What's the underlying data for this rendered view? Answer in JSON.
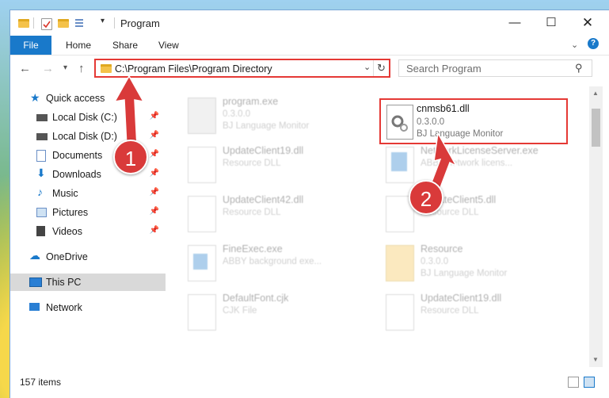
{
  "window": {
    "title": "Program"
  },
  "ribbon": {
    "file": "File",
    "tabs": [
      "Home",
      "Share",
      "View"
    ]
  },
  "address": {
    "path": "C:\\Program Files\\Program Directory"
  },
  "search": {
    "placeholder": "Search Program"
  },
  "sidebar": {
    "items": [
      {
        "label": "Quick access"
      },
      {
        "label": "Local Disk (C:)"
      },
      {
        "label": "Local Disk (D:)"
      },
      {
        "label": "Documents"
      },
      {
        "label": "Downloads"
      },
      {
        "label": "Music"
      },
      {
        "label": "Pictures"
      },
      {
        "label": "Videos"
      },
      {
        "label": "OneDrive"
      },
      {
        "label": "This PC"
      },
      {
        "label": "Network"
      }
    ]
  },
  "files": [
    {
      "name": "program.exe",
      "line1": "0.3.0.0",
      "line2": "BJ Language Monitor"
    },
    {
      "name": "cnmsb61.dll",
      "line1": "0.3.0.0",
      "line2": "BJ Language Monitor"
    },
    {
      "name": "UpdateClient19.dll",
      "line1": "Resource DLL"
    },
    {
      "name": "NetworkLicenseServer.exe",
      "line1": "ABBY network licens..."
    },
    {
      "name": "UpdateClient42.dll",
      "line1": "Resource DLL"
    },
    {
      "name": "UpdateClient5.dll",
      "line1": "Resource DLL"
    },
    {
      "name": "FineExec.exe",
      "line1": "ABBY background exe..."
    },
    {
      "name": "Resource",
      "line1": "0.3.0.0",
      "line2": "BJ Language Monitor"
    },
    {
      "name": "DefaultFont.cjk",
      "line1": "CJK File"
    },
    {
      "name": "UpdateClient19.dll",
      "line1": "Resource DLL"
    }
  ],
  "status": {
    "count": "157 items"
  },
  "callouts": {
    "one": "1",
    "two": "2"
  },
  "colors": {
    "accent": "#1979ca",
    "highlight": "#e53935",
    "badge": "#d93a3a"
  }
}
